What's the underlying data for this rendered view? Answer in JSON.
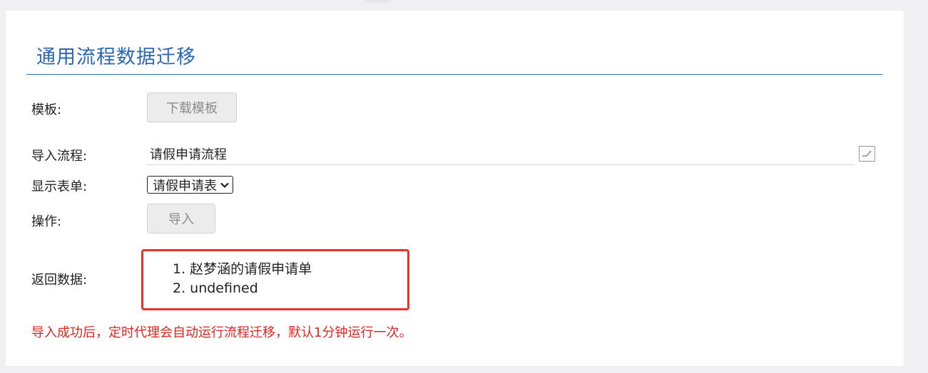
{
  "page": {
    "title": "通用流程数据迁移"
  },
  "template_row": {
    "label": "模板:",
    "button_label": "下载模板"
  },
  "import_flow_row": {
    "label": "导入流程:",
    "value": "请假申请流程",
    "edit_icon": "edit-icon"
  },
  "form_row": {
    "label": "显示表单:",
    "selected": "请假申请表"
  },
  "action_row": {
    "label": "操作:",
    "button_label": "导入"
  },
  "result_row": {
    "label": "返回数据:",
    "items": [
      "1. 赵梦涵的请假申请单",
      "2. undefined"
    ],
    "highlight_color": "#e8322a"
  },
  "note": "导入成功后，定时代理会自动运行流程迁移，默认1分钟运行一次。",
  "colors": {
    "title": "#2a67b5",
    "note": "#e0241c"
  }
}
